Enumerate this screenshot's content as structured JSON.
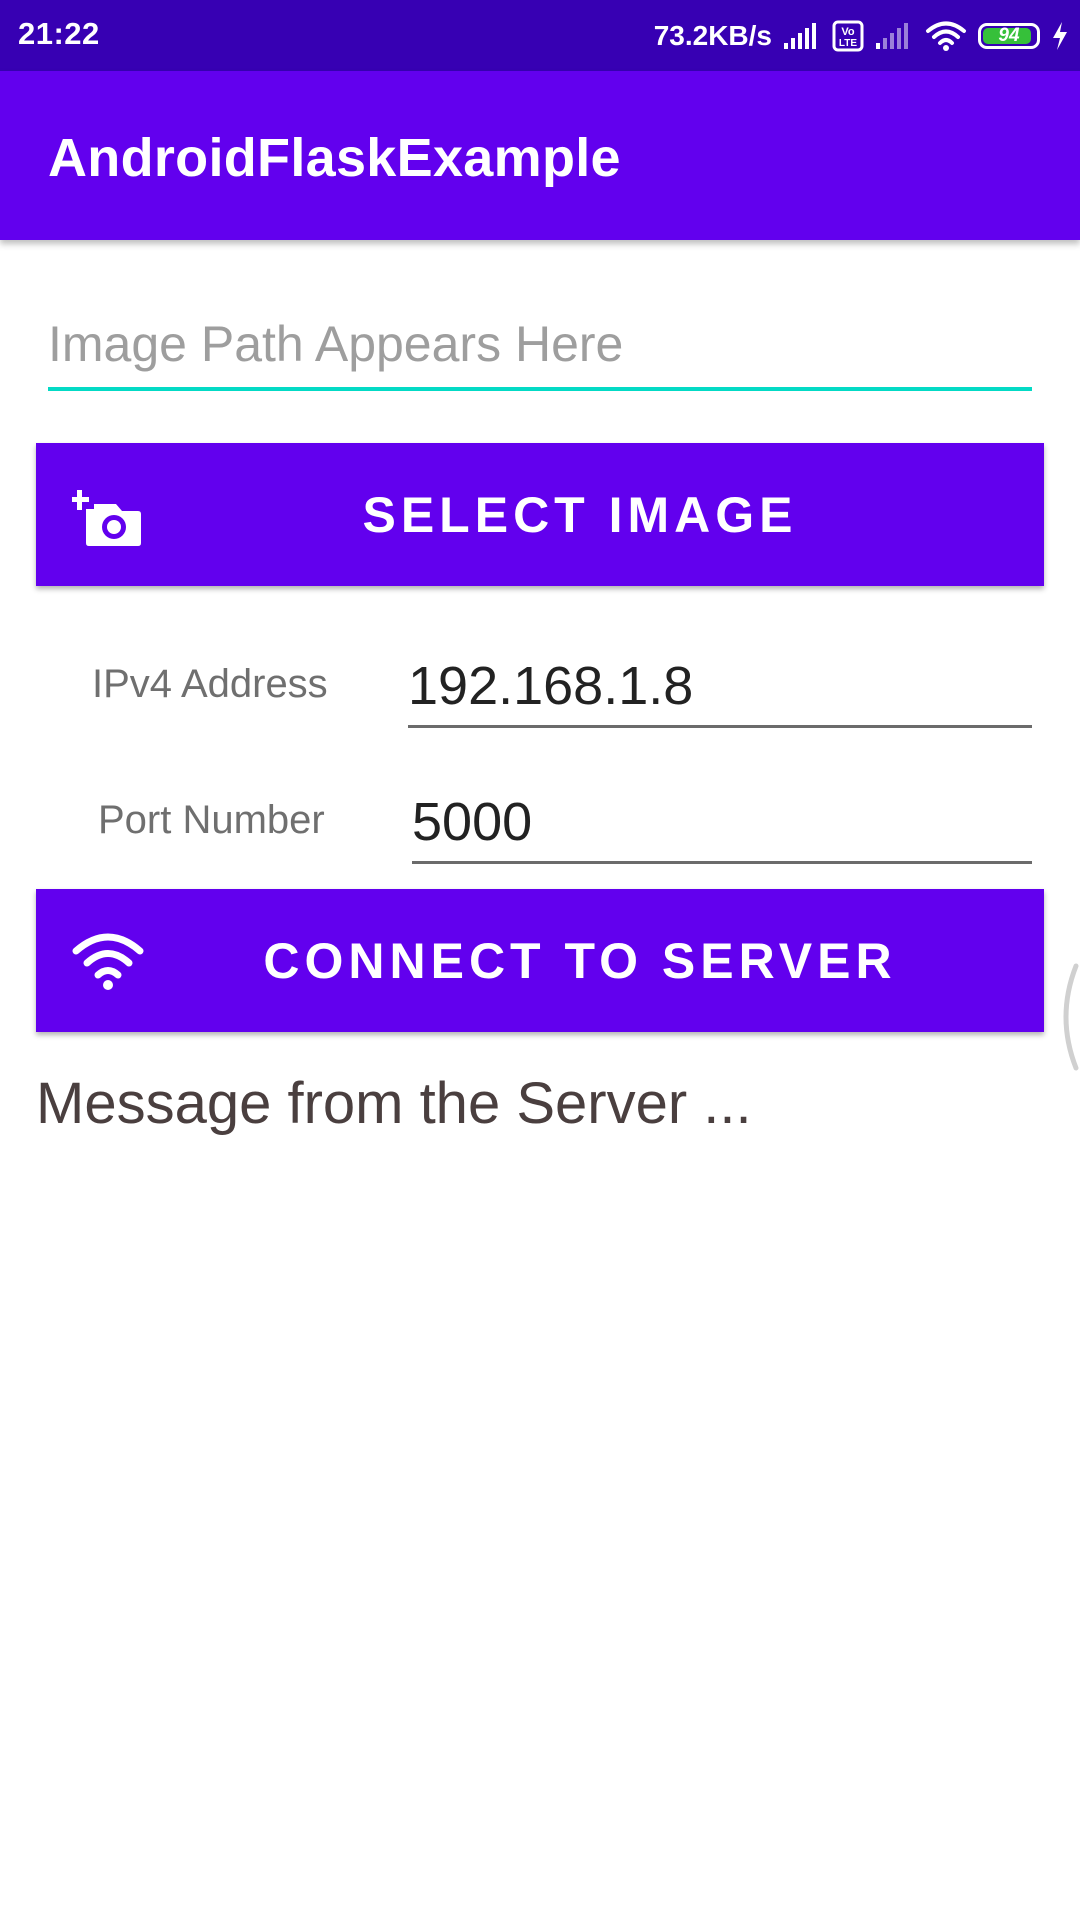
{
  "status_bar": {
    "time": "21:22",
    "net_speed": "73.2KB/s",
    "volte_badge": "Vo LTE",
    "battery_level": "94",
    "icons": [
      "signal-icon",
      "volte-icon",
      "signal-weak-icon",
      "wifi-icon",
      "battery-icon",
      "charging-icon"
    ]
  },
  "app_bar": {
    "title": "AndroidFlaskExample"
  },
  "image_path": {
    "placeholder": "Image Path Appears Here",
    "value": ""
  },
  "select_image_button": {
    "label": "SELECT IMAGE",
    "icon": "add-photo-icon"
  },
  "ip_row": {
    "label": "IPv4 Address",
    "value": "192.168.1.8"
  },
  "port_row": {
    "label": "Port Number",
    "value": "5000"
  },
  "connect_button": {
    "label": "CONNECT TO SERVER",
    "icon": "wifi-icon"
  },
  "server_message": "Message from the Server ...",
  "colors": {
    "status_bar": "#3700b3",
    "primary": "#6200ee",
    "accent": "#03dac5",
    "battery": "#36c03a"
  }
}
